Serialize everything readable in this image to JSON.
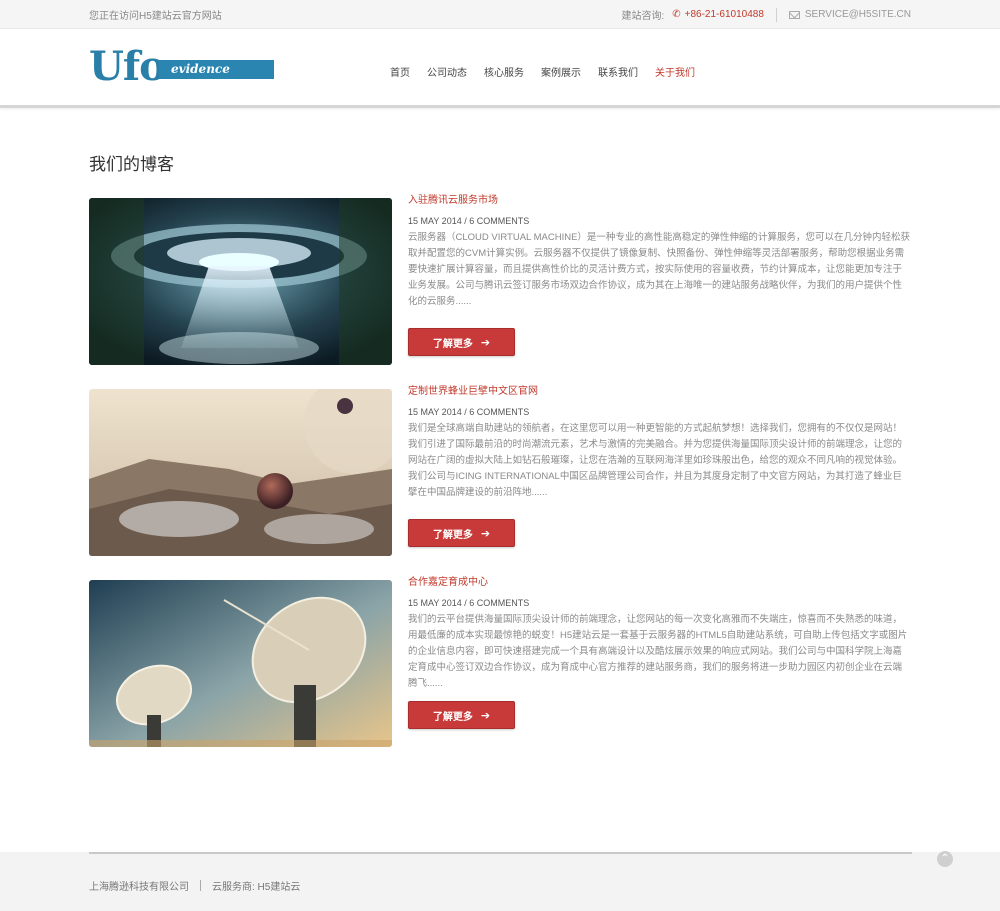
{
  "topbar": {
    "welcome": "您正在访问H5建站云官方网站",
    "consult_label": "建站咨询:",
    "phone": "+86-21-61010488",
    "email": "SERVICE@H5SITE.CN"
  },
  "header": {
    "logo_main": "Ufo",
    "logo_sub": "evidence",
    "nav": [
      "首页",
      "公司动态",
      "核心服务",
      "案例展示",
      "联系我们",
      "关于我们"
    ],
    "nav_active": "关于我们"
  },
  "page_title": "我们的博客",
  "posts": [
    {
      "title": "入驻腾讯云服务市场",
      "date": "15 MAY 2014",
      "comments": "6 COMMENTS",
      "excerpt": "云服务器（CLOUD VIRTUAL MACHINE）是一种专业的高性能高稳定的弹性伸缩的计算服务，您可以在几分钟内轻松获取并配置您的CVM计算实例。云服务器不仅提供了镜像复制、快照备份、弹性伸缩等灵活部署服务，帮助您根据业务需要快速扩展计算容量，而且提供高性价比的灵活计费方式，按实际使用的容量收费，节约计算成本，让您能更加专注于业务发展。公司与腾讯云签订服务市场双边合作协议，成为其在上海唯一的建站服务战略伙伴，为我们的用户提供个性化的云服务......",
      "button": "了解更多"
    },
    {
      "title": "定制世界蜂业巨擘中文区官网",
      "date": "15 MAY 2014",
      "comments": "6 COMMENTS",
      "excerpt": "我们是全球高端自助建站的领航者，在这里您可以用一种更智能的方式起航梦想！选择我们，您拥有的不仅仅是网站！我们引进了国际最前沿的时尚潮流元素，艺术与激情的完美融合。并为您提供海量国际顶尖设计师的前端理念，让您的网站在广阔的虚拟大陆上如钻石般璀璨，让您在浩瀚的互联网海洋里如珍珠般出色，给您的观众不同凡响的视觉体验。我们公司与ICING INTERNATIONAL中国区品牌管理公司合作，并且为其度身定制了中文官方网站，为其打造了蜂业巨擘在中国品牌建设的前沿阵地......",
      "button": "了解更多"
    },
    {
      "title": "合作嘉定育成中心",
      "date": "15 MAY 2014",
      "comments": "6 COMMENTS",
      "excerpt": "我们的云平台提供海量国际顶尖设计师的前端理念，让您网站的每一次变化高雅而不失端庄，惊喜而不失熟悉的味道，用最低廉的成本实现最惊艳的蜕变！H5建站云是一套基于云服务器的HTML5自助建站系统，可自助上传包括文字或图片的企业信息内容，即可快速搭建完成一个具有高端设计以及酷炫展示效果的响应式网站。我们公司与中国科学院上海嘉定育成中心签订双边合作协议，成为育成中心官方推荐的建站服务商，我们的服务将进一步助力园区内初创企业在云端腾飞......",
      "button": "了解更多"
    }
  ],
  "footer": {
    "company": "上海腾逊科技有限公司",
    "provider": "云服务商: H5建站云"
  },
  "colors": {
    "accent_red": "#c0392b",
    "brand_blue": "#2a7fa8"
  }
}
